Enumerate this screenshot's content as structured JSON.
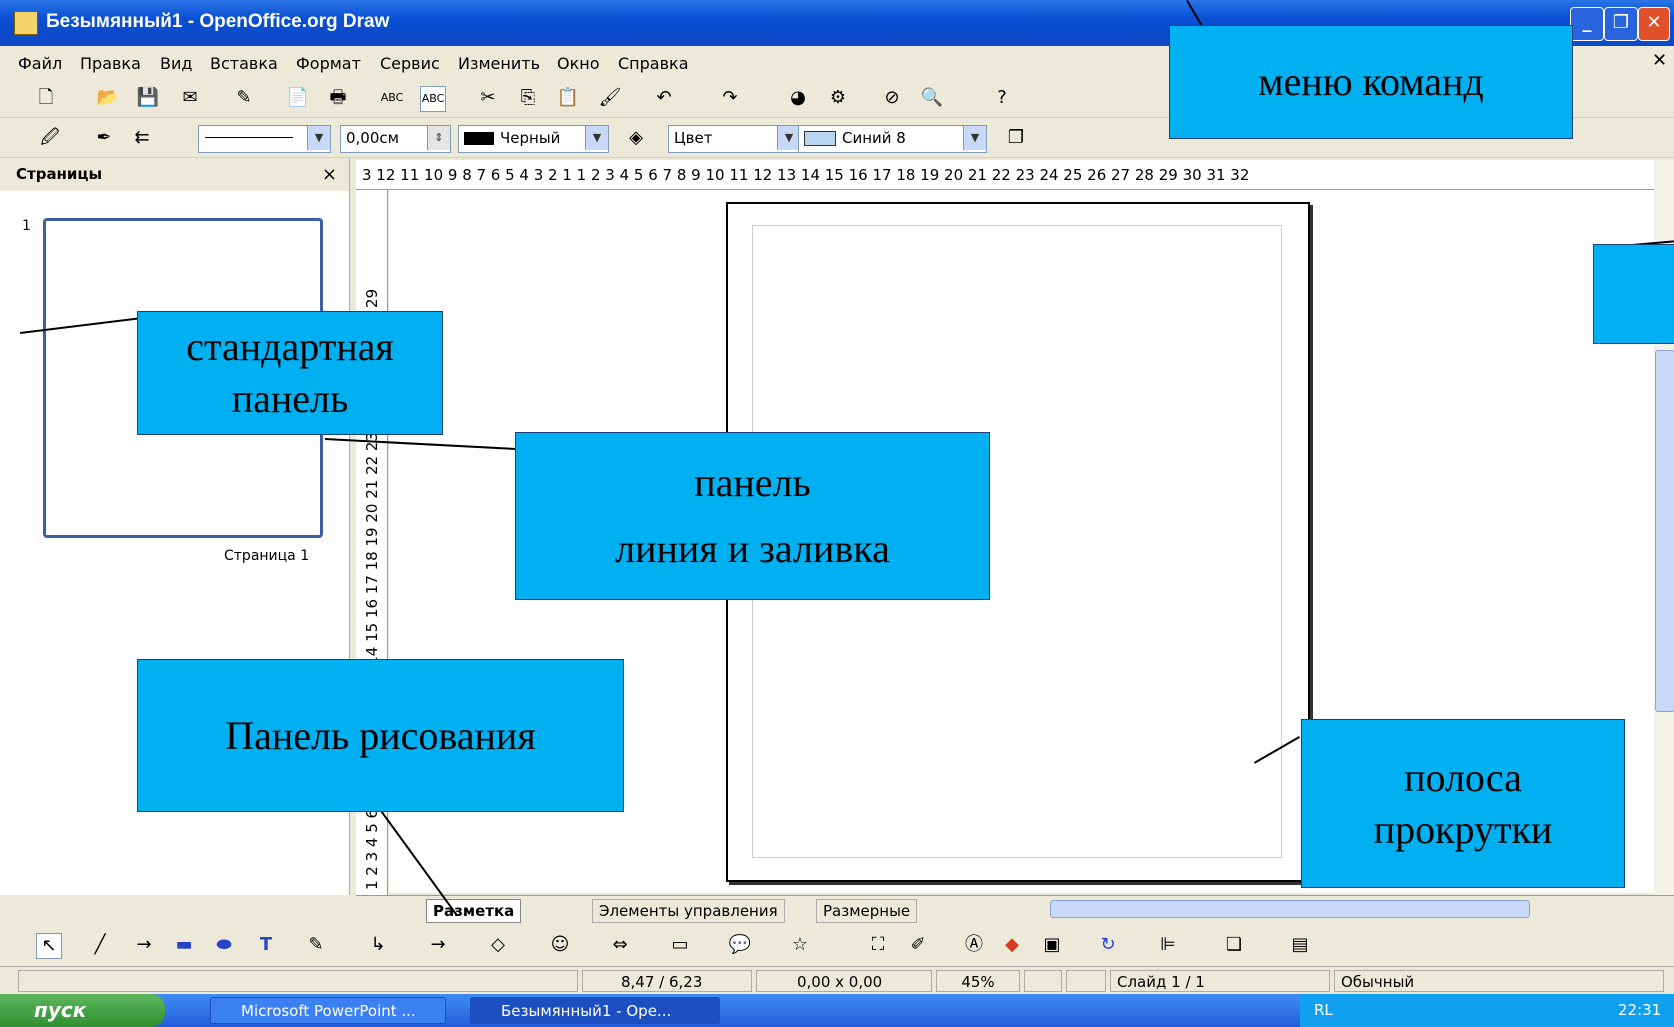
{
  "window": {
    "title": "Безымянный1 - OpenOffice.org Draw"
  },
  "menu": [
    "Файл",
    "Правка",
    "Вид",
    "Вставка",
    "Формат",
    "Сервис",
    "Изменить",
    "Окно",
    "Справка"
  ],
  "line_toolbar": {
    "line_width": "0,00см",
    "line_color": "Черный",
    "fill_type": "Цвет",
    "fill_color": "Синий 8"
  },
  "pages_panel": {
    "title": "Страницы",
    "close_glyph": "×",
    "page_number": "1",
    "page_caption": "Страница 1"
  },
  "ruler": {
    "horizontal": "3 12 11 10 9 8 7 6 5 4 3 2 1    1 2 3 4 5 6 7 8 9 10 11 12 13 14 15 16 17 18 19 20 21 22 23 24 25 26 27 28 29 30 31 32",
    "vertical": "1 2 3 4 5 6 7 8 9 10 11 12 13 14 15 16 17 18 19 20 21 22 23 24 25 26 27 28 29"
  },
  "tabs": [
    "Разметка",
    "Элементы управления",
    "Размерные"
  ],
  "status": {
    "position": "8,47 / 6,23",
    "size": "0,00 x 0,00",
    "zoom": "45%",
    "slide": "Слайд 1 / 1",
    "mode": "Обычный"
  },
  "taskbar": {
    "start": "пуск",
    "tasks": [
      "Microsoft PowerPoint ...",
      "Безымянный1 - Ope..."
    ],
    "lang": "RL",
    "clock": "22:31"
  },
  "callouts": {
    "menu": "меню команд",
    "standard_1": "стандартная",
    "standard_2": "панель",
    "line_1": "панель",
    "line_2": "линия и заливка",
    "drawing": "Панель рисования",
    "scroll_1": "полоса",
    "scroll_2": "прокрутки"
  },
  "colors": {
    "callout": "#00b0f0",
    "titlebar": "#0a4fd4",
    "chrome": "#ece9d8"
  }
}
